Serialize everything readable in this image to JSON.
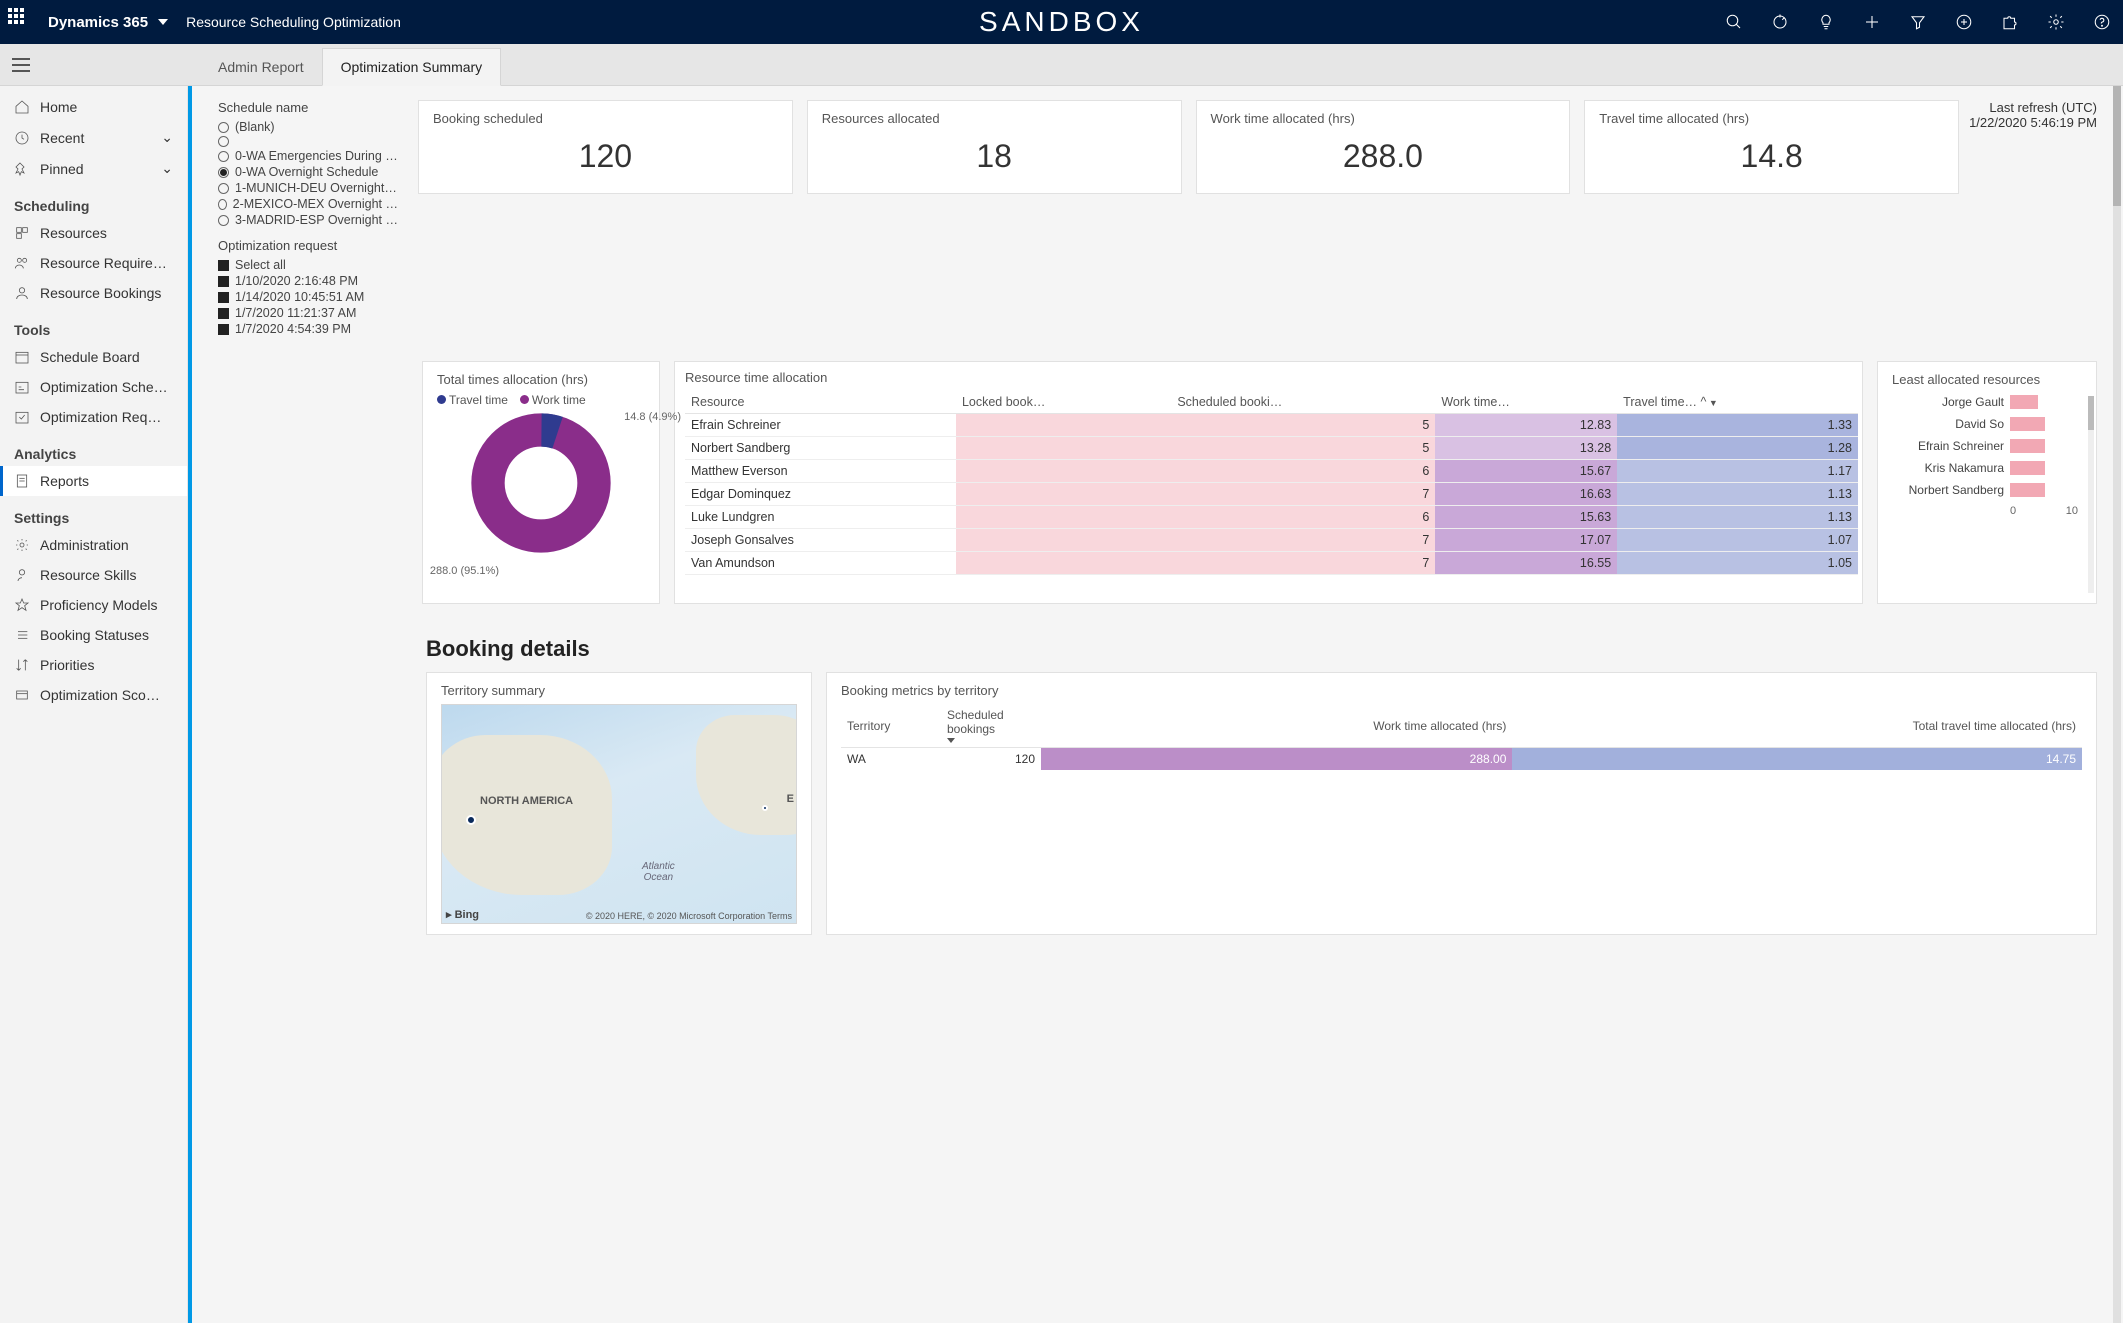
{
  "header": {
    "brand": "Dynamics 365",
    "app_title": "Resource Scheduling Optimization",
    "env": "SANDBOX"
  },
  "tabs": {
    "admin": "Admin Report",
    "opt": "Optimization Summary"
  },
  "sidebar": {
    "home": "Home",
    "recent": "Recent",
    "pinned": "Pinned",
    "sec_sched": "Scheduling",
    "resources": "Resources",
    "resreq": "Resource Require…",
    "resbook": "Resource Bookings",
    "sec_tools": "Tools",
    "schedboard": "Schedule Board",
    "optsched": "Optimization Sche…",
    "optreq": "Optimization Req…",
    "sec_analytics": "Analytics",
    "reports": "Reports",
    "sec_settings": "Settings",
    "admin": "Administration",
    "skills": "Resource Skills",
    "prof": "Proficiency Models",
    "bookstat": "Booking Statuses",
    "prio": "Priorities",
    "optsco": "Optimization Sco…"
  },
  "filters": {
    "sched_title": "Schedule name",
    "sched_items": [
      "(Blank)",
      "",
      "0-WA Emergencies During …",
      "0-WA Overnight Schedule",
      "1-MUNICH-DEU Overnight…",
      "2-MEXICO-MEX Overnight …",
      "3-MADRID-ESP Overnight …"
    ],
    "sched_selected_index": 3,
    "opt_title": "Optimization request",
    "opt_items": [
      "Select all",
      "1/10/2020 2:16:48 PM",
      "1/14/2020 10:45:51 AM",
      "1/7/2020 11:21:37 AM",
      "1/7/2020 4:54:39 PM"
    ]
  },
  "refresh": {
    "label": "Last refresh (UTC)",
    "value": "1/22/2020 5:46:19 PM"
  },
  "kpis": {
    "booking": {
      "label": "Booking scheduled",
      "value": "120"
    },
    "resources": {
      "label": "Resources allocated",
      "value": "18"
    },
    "work": {
      "label": "Work time allocated (hrs)",
      "value": "288.0"
    },
    "travel": {
      "label": "Travel time allocated (hrs)",
      "value": "14.8"
    }
  },
  "donut": {
    "title": "Total times allocation (hrs)",
    "legend_travel": "Travel time",
    "legend_work": "Work time",
    "callout_travel": "14.8 (4.9%)",
    "callout_work": "288.0 (95.1%)"
  },
  "res_table": {
    "title": "Resource time allocation",
    "cols": {
      "resource": "Resource",
      "locked": "Locked book…",
      "sched": "Scheduled booki…",
      "work": "Work time…",
      "travel": "Travel time…"
    },
    "rows": [
      {
        "name": "Efrain Schreiner",
        "sched": "5",
        "work": "12.83",
        "travel": "1.33"
      },
      {
        "name": "Norbert Sandberg",
        "sched": "5",
        "work": "13.28",
        "travel": "1.28"
      },
      {
        "name": "Matthew Everson",
        "sched": "6",
        "work": "15.67",
        "travel": "1.17"
      },
      {
        "name": "Edgar Dominquez",
        "sched": "7",
        "work": "16.63",
        "travel": "1.13"
      },
      {
        "name": "Luke Lundgren",
        "sched": "6",
        "work": "15.63",
        "travel": "1.13"
      },
      {
        "name": "Joseph Gonsalves",
        "sched": "7",
        "work": "17.07",
        "travel": "1.07"
      },
      {
        "name": "Van Amundson",
        "sched": "7",
        "work": "16.55",
        "travel": "1.05"
      }
    ]
  },
  "least": {
    "title": "Least allocated resources",
    "rows": [
      {
        "name": "Jorge Gault",
        "v": 4
      },
      {
        "name": "David So",
        "v": 5
      },
      {
        "name": "Efrain Schreiner",
        "v": 5
      },
      {
        "name": "Kris Nakamura",
        "v": 5
      },
      {
        "name": "Norbert Sandberg",
        "v": 5
      }
    ],
    "axis_min": "0",
    "axis_max": "10"
  },
  "booking_details": {
    "section": "Booking details",
    "territory_title": "Territory summary",
    "map": {
      "na": "NORTH AMERICA",
      "eu": "E",
      "ocean": "Atlantic\nOcean",
      "bing": "Bing",
      "copy": "© 2020 HERE, © 2020 Microsoft Corporation  Terms"
    },
    "metric_title": "Booking metrics by territory",
    "metric_cols": {
      "terr": "Territory",
      "sched": "Scheduled\nbookings",
      "work": "Work time allocated (hrs)",
      "travel": "Total travel time allocated (hrs)"
    },
    "metric_row": {
      "terr": "WA",
      "sched": "120",
      "work": "288.00",
      "travel": "14.75"
    }
  },
  "chart_data": [
    {
      "type": "pie",
      "title": "Total times allocation (hrs)",
      "series": [
        {
          "name": "Travel time",
          "value": 14.8,
          "pct": 4.9,
          "color": "#2f3b8f"
        },
        {
          "name": "Work time",
          "value": 288.0,
          "pct": 95.1,
          "color": "#8a2d8a"
        }
      ]
    },
    {
      "type": "bar",
      "title": "Least allocated resources",
      "orientation": "horizontal",
      "categories": [
        "Jorge Gault",
        "David So",
        "Efrain Schreiner",
        "Kris Nakamura",
        "Norbert Sandberg"
      ],
      "values": [
        4,
        5,
        5,
        5,
        5
      ],
      "xlim": [
        0,
        10
      ],
      "color": "#f2a8b4"
    },
    {
      "type": "table",
      "title": "Resource time allocation",
      "columns": [
        "Resource",
        "Locked bookings",
        "Scheduled bookings",
        "Work time (hrs)",
        "Travel time (hrs)"
      ],
      "rows": [
        [
          "Efrain Schreiner",
          null,
          5,
          12.83,
          1.33
        ],
        [
          "Norbert Sandberg",
          null,
          5,
          13.28,
          1.28
        ],
        [
          "Matthew Everson",
          null,
          6,
          15.67,
          1.17
        ],
        [
          "Edgar Dominquez",
          null,
          7,
          16.63,
          1.13
        ],
        [
          "Luke Lundgren",
          null,
          6,
          15.63,
          1.13
        ],
        [
          "Joseph Gonsalves",
          null,
          7,
          17.07,
          1.07
        ],
        [
          "Van Amundson",
          null,
          7,
          16.55,
          1.05
        ]
      ]
    },
    {
      "type": "bar",
      "title": "Booking metrics by territory",
      "categories": [
        "WA"
      ],
      "series": [
        {
          "name": "Scheduled bookings",
          "values": [
            120
          ]
        },
        {
          "name": "Work time allocated (hrs)",
          "values": [
            288.0
          ]
        },
        {
          "name": "Total travel time allocated (hrs)",
          "values": [
            14.75
          ]
        }
      ]
    }
  ]
}
